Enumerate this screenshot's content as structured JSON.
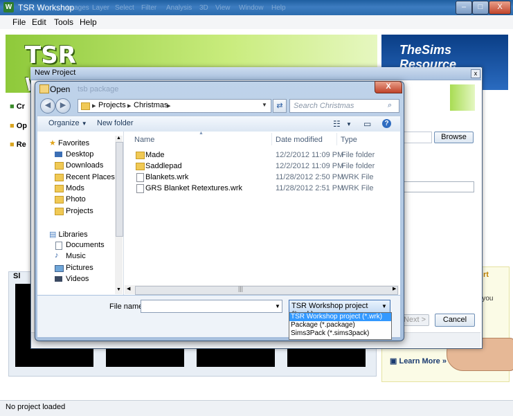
{
  "main": {
    "title": "TSR Workshop",
    "app_icon": "W",
    "faded_toolbar": [
      "Images",
      "Layer",
      "Select",
      "Filter",
      "Analysis",
      "3D",
      "View",
      "Window",
      "Help"
    ],
    "window_buttons": {
      "minimize": "–",
      "maximize": "□",
      "close": "X"
    },
    "menu": [
      "File",
      "Edit",
      "Tools",
      "Help"
    ],
    "logo_text": "TSR",
    "logo_tail": "Wo",
    "sims_logo": "TheSims Resource",
    "side_items": [
      "Cr",
      "Op",
      "Re"
    ],
    "browse_label": "Browse",
    "next_label": "Next >",
    "cancel_label": "Cancel",
    "filmstrip_label": "Sl",
    "ad": {
      "title_fragment": "rt",
      "text_fragment": "e you",
      "learn_more": "Learn More »"
    },
    "status": "No project loaded"
  },
  "new_project": {
    "title": "New Project",
    "close": "x"
  },
  "open_dialog": {
    "title": "Open",
    "title_faded": "tsb package",
    "close": "X",
    "breadcrumb": [
      "Projects",
      "Christmas"
    ],
    "search_placeholder": "Search Christmas",
    "toolbar": {
      "organize": "Organize",
      "new_folder": "New folder"
    },
    "nav": {
      "favorites_header": "Favorites",
      "favorites": [
        "Desktop",
        "Downloads",
        "Recent Places",
        "Mods",
        "Photo",
        "Projects"
      ],
      "libraries_header": "Libraries",
      "libraries": [
        "Documents",
        "Music",
        "Pictures",
        "Videos"
      ]
    },
    "columns": {
      "name": "Name",
      "date": "Date modified",
      "type": "Type"
    },
    "files": [
      {
        "name": "Made",
        "date": "12/2/2012 11:09 PM",
        "type": "File folder",
        "kind": "folder"
      },
      {
        "name": "Saddlepad",
        "date": "12/2/2012 11:09 PM",
        "type": "File folder",
        "kind": "folder"
      },
      {
        "name": "Blankets.wrk",
        "date": "11/28/2012 2:50 PM",
        "type": "WRK File",
        "kind": "file"
      },
      {
        "name": "GRS Blanket Retextures.wrk",
        "date": "11/28/2012 2:51 PM",
        "type": "WRK File",
        "kind": "file"
      }
    ],
    "file_name_label": "File name:",
    "file_name_value": "",
    "file_type_selected": "TSR Workshop project (*.wrk)",
    "file_type_options": [
      "TSR Workshop project (*.wrk)",
      "Package (*.package)",
      "Sims3Pack (*.sims3pack)"
    ]
  }
}
